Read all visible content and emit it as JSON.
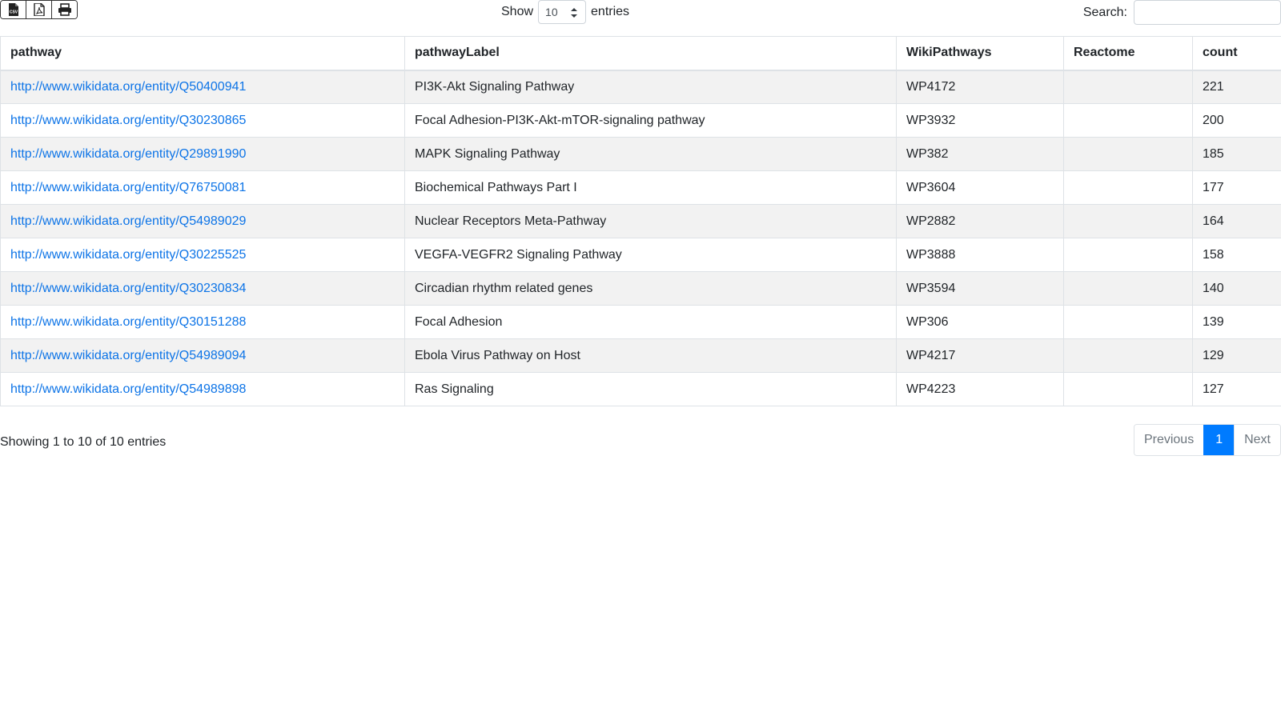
{
  "toolbar": {
    "export_buttons": [
      {
        "icon": "csv-file-icon",
        "label": "CSV"
      },
      {
        "icon": "pdf-file-icon"
      },
      {
        "icon": "print-icon"
      }
    ]
  },
  "length": {
    "show_label": "Show",
    "selected": "10",
    "entries_label": "entries"
  },
  "search": {
    "label": "Search:",
    "value": "",
    "placeholder": ""
  },
  "table": {
    "headers": [
      "pathway",
      "pathwayLabel",
      "WikiPathways",
      "Reactome",
      "count"
    ],
    "rows": [
      {
        "pathway": "http://www.wikidata.org/entity/Q50400941",
        "label": "PI3K-Akt Signaling Pathway",
        "wp": "WP4172",
        "reactome": "",
        "count": "221"
      },
      {
        "pathway": "http://www.wikidata.org/entity/Q30230865",
        "label": "Focal Adhesion-PI3K-Akt-mTOR-signaling pathway",
        "wp": "WP3932",
        "reactome": "",
        "count": "200"
      },
      {
        "pathway": "http://www.wikidata.org/entity/Q29891990",
        "label": "MAPK Signaling Pathway",
        "wp": "WP382",
        "reactome": "",
        "count": "185"
      },
      {
        "pathway": "http://www.wikidata.org/entity/Q76750081",
        "label": "Biochemical Pathways Part I",
        "wp": "WP3604",
        "reactome": "",
        "count": "177"
      },
      {
        "pathway": "http://www.wikidata.org/entity/Q54989029",
        "label": "Nuclear Receptors Meta-Pathway",
        "wp": "WP2882",
        "reactome": "",
        "count": "164"
      },
      {
        "pathway": "http://www.wikidata.org/entity/Q30225525",
        "label": "VEGFA-VEGFR2 Signaling Pathway",
        "wp": "WP3888",
        "reactome": "",
        "count": "158"
      },
      {
        "pathway": "http://www.wikidata.org/entity/Q30230834",
        "label": "Circadian rhythm related genes",
        "wp": "WP3594",
        "reactome": "",
        "count": "140"
      },
      {
        "pathway": "http://www.wikidata.org/entity/Q30151288",
        "label": "Focal Adhesion",
        "wp": "WP306",
        "reactome": "",
        "count": "139"
      },
      {
        "pathway": "http://www.wikidata.org/entity/Q54989094",
        "label": "Ebola Virus Pathway on Host",
        "wp": "WP4217",
        "reactome": "",
        "count": "129"
      },
      {
        "pathway": "http://www.wikidata.org/entity/Q54989898",
        "label": "Ras Signaling",
        "wp": "WP4223",
        "reactome": "",
        "count": "127"
      }
    ]
  },
  "info": "Showing 1 to 10 of 10 entries",
  "pagination": {
    "previous": "Previous",
    "current": "1",
    "next": "Next"
  },
  "colors": {
    "link": "#0d74e7",
    "active_page": "#007bff",
    "stripe": "#f2f2f2"
  }
}
